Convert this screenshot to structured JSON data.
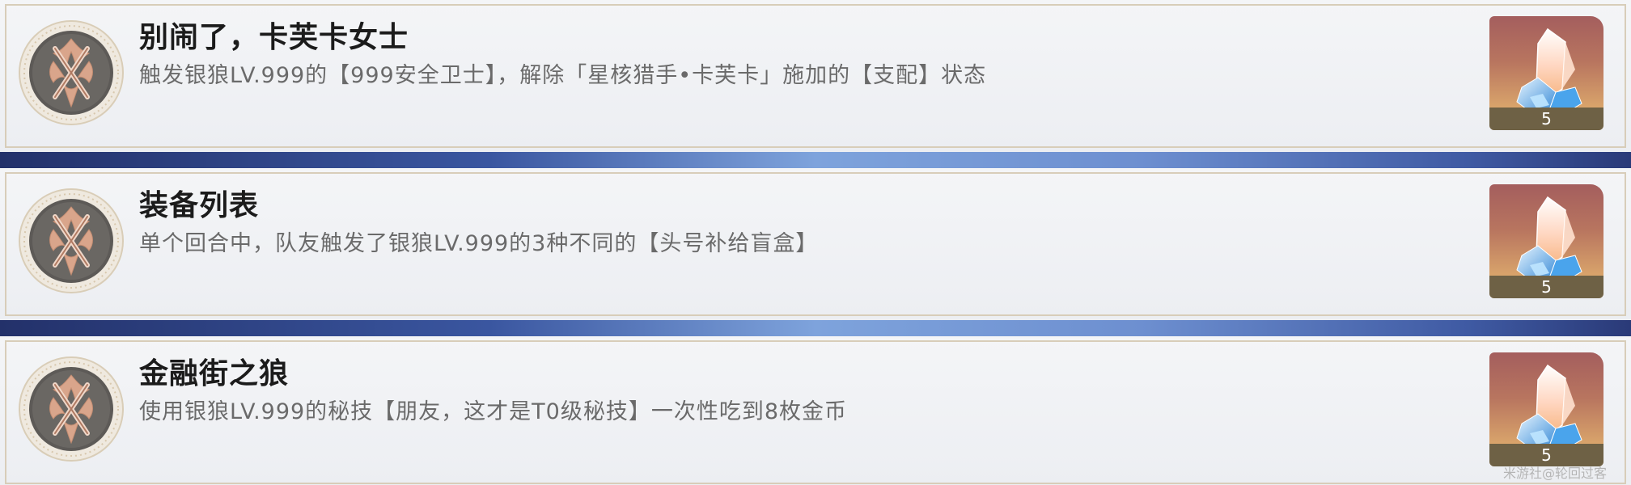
{
  "achievements": [
    {
      "title": "别闹了，卡芙卡女士",
      "description": "触发银狼LV.999的【999安全卫士】，解除「星核猎手•卡芙卡」施加的【支配】状态",
      "reward_icon": "stellar-jade-icon",
      "reward_count": "5",
      "badge_icon": "achievement-badge-icon"
    },
    {
      "title": "装备列表",
      "description": "单个回合中，队友触发了银狼LV.999的3种不同的【头号补给盲盒】",
      "reward_icon": "stellar-jade-icon",
      "reward_count": "5",
      "badge_icon": "achievement-badge-icon"
    },
    {
      "title": "金融街之狼",
      "description": "使用银狼LV.999的秘技【朋友，这才是T0级秘技】一次性吃到8枚金币",
      "reward_icon": "stellar-jade-icon",
      "reward_count": "5",
      "badge_icon": "achievement-badge-icon"
    }
  ],
  "watermark": "米游社@轮回过客",
  "colors": {
    "separator": "#6d8fd0",
    "card_bg": "#f1f2f5",
    "card_border": "#d8cdb9",
    "title": "#1b1b1b",
    "description": "#6a6a6a",
    "badge_outer": "#e3d9c6",
    "badge_inner": "#5c5955",
    "badge_emblem": "#d9a58b"
  }
}
